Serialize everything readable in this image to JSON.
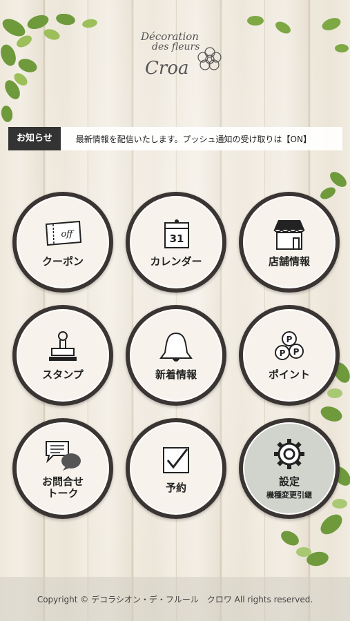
{
  "logo": {
    "line1": "Décoration",
    "line2": "des fleurs",
    "line3": "Croa"
  },
  "notice": {
    "tag": "お知らせ",
    "message": "最新情報を配信いたします。プッシュ通知の受け取りは【ON】"
  },
  "menu": [
    {
      "label": "クーポン",
      "icon": "coupon-icon",
      "icon_text": "off"
    },
    {
      "label": "カレンダー",
      "icon": "calendar-icon",
      "icon_text": "31"
    },
    {
      "label": "店舗情報",
      "icon": "store-icon"
    },
    {
      "label": "スタンプ",
      "icon": "stamp-icon"
    },
    {
      "label": "新着情報",
      "icon": "bell-icon"
    },
    {
      "label": "ポイント",
      "icon": "coins-icon",
      "icon_text": "P"
    },
    {
      "label": "お問合せ\nトーク",
      "icon": "chat-icon"
    },
    {
      "label": "予約",
      "icon": "reservation-checkbox-icon"
    },
    {
      "label": "設定",
      "sub": "機種変更引継",
      "icon": "gear-icon"
    }
  ],
  "footer": {
    "copyright": "Copyright © デコラシオン・デ・フルール　クロワ All rights reserved."
  },
  "colors": {
    "circle_ring": "#3a3533",
    "circle_fill": "#f7f3ec",
    "notice_tag": "#333333"
  }
}
